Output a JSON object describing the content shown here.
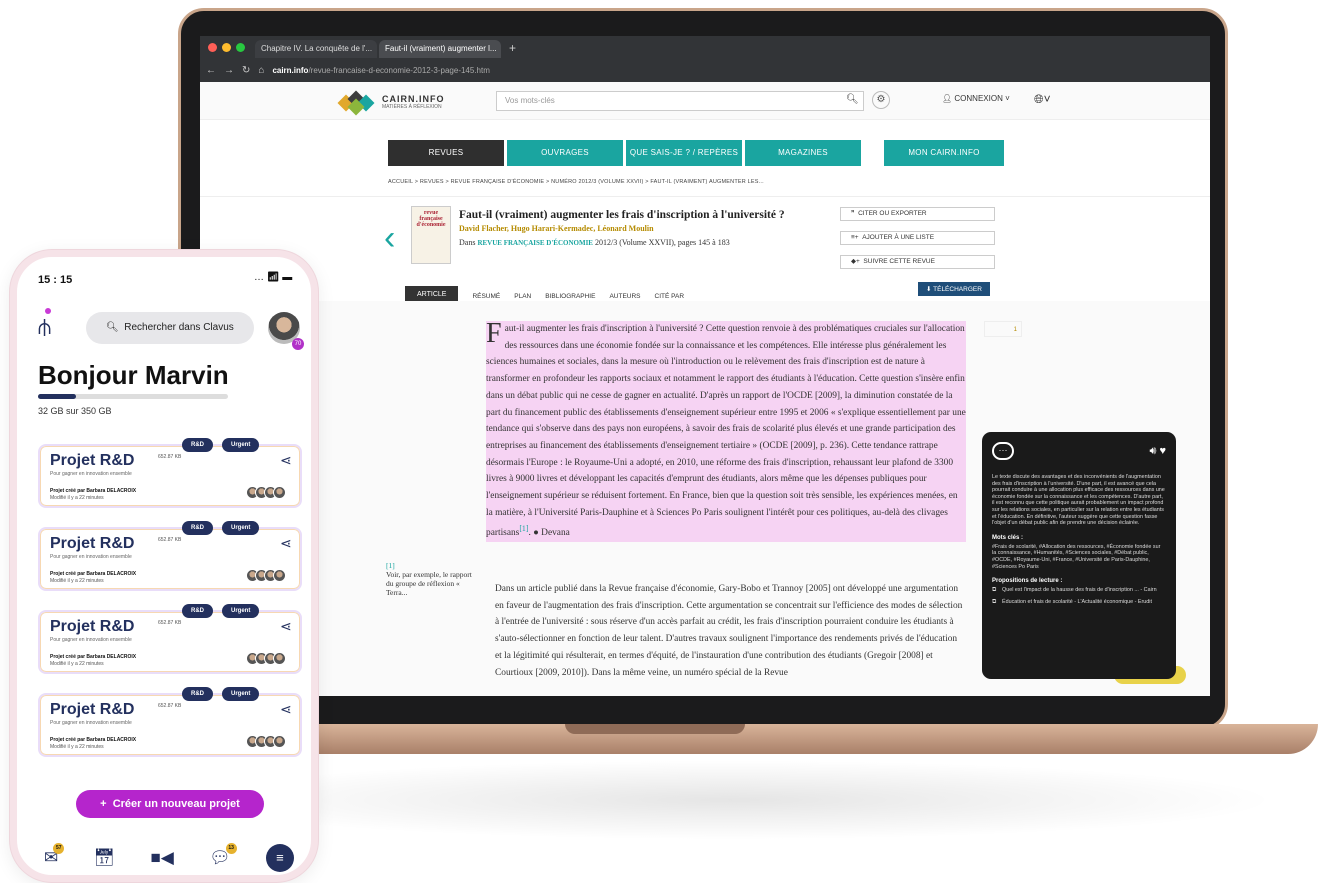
{
  "browser": {
    "tab1": "Chapitre IV. La conquête de l'...",
    "tab2": "Faut-il (vraiment) augmenter l...",
    "url_host": "cairn.info",
    "url_path": "/revue-francaise-d-economie-2012-3-page-145.htm"
  },
  "site": {
    "logo": "CAIRN.INFO",
    "tagline": "MATIÈRES À RÉFLEXION",
    "search_placeholder": "Vos mots-clés",
    "login": "Connexion",
    "nav": [
      {
        "label": "Revues",
        "color": "#2f2f2f",
        "w": 116
      },
      {
        "label": "Ouvrages",
        "color": "#1aa5a0",
        "w": 116
      },
      {
        "label": "Que sais-je ? / Repères",
        "color": "#1aa5a0",
        "w": 116
      },
      {
        "label": "Magazines",
        "color": "#1aa5a0",
        "w": 116
      },
      {
        "label": "Mon cairn.info",
        "color": "#1aa5a0",
        "w": 116
      }
    ],
    "breadcrumb": "Accueil  >  Revues  >  Revue française d'économie  >  Numéro 2012/3 (Volume XXVII)  >  Faut-il (vraiment) augmenter les..."
  },
  "article": {
    "cover_label": "revue française d'économie",
    "title": "Faut-il (vraiment) augmenter les frais d'inscription à l'université ?",
    "authors": "David Flacher, Hugo Harari-Kermadec, Léonard Moulin",
    "source_prefix": "Dans",
    "journal": "Revue française d'économie",
    "source_suffix": " 2012/3 (Volume XXVII), pages 145 à 183",
    "actions": [
      "Citer ou exporter",
      "Ajouter à une liste",
      "Suivre cette revue"
    ],
    "tab_article": "Article",
    "tabs": [
      "Résumé",
      "Plan",
      "Bibliographie",
      "Auteurs",
      "Cité par"
    ],
    "download": "Télécharger",
    "page_number": "1",
    "para1": "aut-il augmenter les frais d'inscription à l'université ? Cette question renvoie à des problématiques cruciales sur l'allocation des ressources dans une économie fondée sur la connaissance et les compétences. Elle intéresse plus généralement les sciences humaines et sociales, dans la mesure où l'introduction ou le relèvement des frais d'inscription est de nature à transformer en profondeur les rapports sociaux et notamment le rapport des étudiants à l'éducation. Cette question s'insère enfin dans un débat public qui ne cesse de gagner en actualité. D'après un rapport de l'OCDE [2009], la diminution constatée de la part du financement public des établissements d'enseignement supérieur entre 1995 et 2006 « s'explique essentiellement par une tendance qui s'observe dans des pays non européens, à savoir des frais de scolarité plus élevés et une grande participation des entreprises au financement des établissements d'enseignement tertiaire » (OCDE [2009], p. 236). Cette tendance rattrape désormais l'Europe : le Royaume-Uni a adopté, en 2010, une réforme des frais d'inscription, rehaussant leur plafond de 3300 livres à 9000 livres et développant les capacités d'emprunt des étudiants, alors même que les dépenses publiques pour l'enseignement supérieur se réduisent fortement. En France, bien que la question soit très sensible, les expériences menées, en la matière, à l'Université Paris-Dauphine et à Sciences Po Paris soulignent l'intérêt pour ces politiques, au-delà des clivages partisans",
    "para1_drop": "F",
    "para1_ref": "[1]",
    "devana": "Devana",
    "para2": "Dans un article publié dans la Revue française d'économie, Gary-Bobo et Trannoy [2005] ont développé une argumentation en faveur de l'augmentation des frais d'inscription. Cette argumentation se concentrait sur l'efficience des modes de sélection à l'entrée de l'université : sous réserve d'un accès parfait au crédit, les frais d'inscription pourraient conduire les étudiants à s'auto-sélectionner en fonction de leur talent. D'autres travaux soulignent l'importance des rendements privés de l'éducation et la légitimité qui résulterait, en termes d'équité, de l'instauration d'une contribution des étudiants (Gregoir [2008] et Courtioux [2009, 2010]). Dans la même veine, un numéro spécial de la Revue",
    "footnote_ref": "[1]",
    "footnote": "Voir, par exemple, le rapport du groupe de réflexion « Terra..."
  },
  "ai_panel": {
    "summary": "Le texte discute des avantages et des inconvénients de l'augmentation des frais d'inscription à l'université. D'une part, il est avancé que cela pourrait conduire à une allocation plus efficace des ressources dans une économie fondée sur la connaissance et les compétences. D'autre part, il est reconnu que cette politique aurait probablement un impact profond sur les relations sociales, en particulier sur la relation entre les étudiants et l'éducation. En définitive, l'auteur suggère que cette question fasse l'objet d'un débat public afin de prendre une décision éclairée.",
    "keywords_title": "Mots clés :",
    "keywords": "#Frais de scolarité, #Allocation des ressources, #Économie fondée sur la connaissance, #Humanités, #Sciences sociales, #Débat public, #OCDE, #Royaume-Uni, #France, #Université de Paris-Dauphine, #Sciences Po Paris",
    "reco_title": "Propositions de lecture :",
    "reco": [
      "Quel est l'impact de la hausse des frais de d'inscription ... - Cairn",
      "Éducation et frais de scolarité - L'Actualité économique - Erudit"
    ]
  },
  "phone": {
    "time": "15 : 15",
    "search": "Rechercher dans Clavus",
    "avatar_badge": "70",
    "greeting": "Bonjour Marvin",
    "storage": "32 GB sur 350 GB",
    "storage_fraction": 0.09,
    "cards": [
      {
        "title": "Projet R&D",
        "size": "652.87 KB",
        "subtitle": "Pour gagner en innovation ensemble",
        "by": "Projet créé par Barbara DELACROIX",
        "modified": "Modifié il y a 22 minutes",
        "tags": [
          "R&D",
          "Urgent"
        ]
      },
      {
        "title": "Projet R&D",
        "size": "652.87 KB",
        "subtitle": "Pour gagner en innovation ensemble",
        "by": "Projet créé par Barbara DELACROIX",
        "modified": "Modifié il y a 22 minutes",
        "tags": [
          "R&D",
          "Urgent"
        ]
      },
      {
        "title": "Projet R&D",
        "size": "652.87 KB",
        "subtitle": "Pour gagner en innovation ensemble",
        "by": "Projet créé par Barbara DELACROIX",
        "modified": "Modifié il y a 22 minutes",
        "tags": [
          "R&D",
          "Urgent"
        ]
      },
      {
        "title": "Projet R&D",
        "size": "652.87 KB",
        "subtitle": "Pour gagner en innovation ensemble",
        "by": "Projet créé par Barbara DELACROIX",
        "modified": "Modifié il y a 22 minutes",
        "tags": [
          "R&D",
          "Urgent"
        ]
      }
    ],
    "create_label": "Créer un nouveau projet",
    "nav_badges": {
      "mail": "57",
      "chat": "13"
    }
  }
}
